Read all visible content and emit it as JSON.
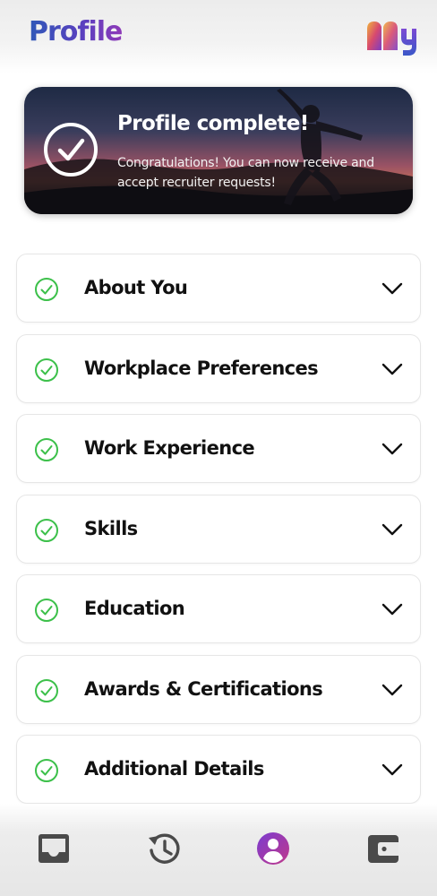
{
  "header": {
    "title": "Profile",
    "logo_icon": "brand-logo-icon"
  },
  "banner": {
    "icon": "check-circle-icon",
    "title": "Profile complete!",
    "text": "Congratulations! You can now receive and accept recruiter requests!"
  },
  "sections": [
    {
      "label": "About You",
      "status_icon": "check-circle-icon",
      "expand_icon": "chevron-down-icon"
    },
    {
      "label": "Workplace Preferences",
      "status_icon": "check-circle-icon",
      "expand_icon": "chevron-down-icon"
    },
    {
      "label": "Work Experience",
      "status_icon": "check-circle-icon",
      "expand_icon": "chevron-down-icon"
    },
    {
      "label": "Skills",
      "status_icon": "check-circle-icon",
      "expand_icon": "chevron-down-icon"
    },
    {
      "label": "Education",
      "status_icon": "check-circle-icon",
      "expand_icon": "chevron-down-icon"
    },
    {
      "label": "Awards & Certifications",
      "status_icon": "check-circle-icon",
      "expand_icon": "chevron-down-icon"
    },
    {
      "label": "Additional Details",
      "status_icon": "check-circle-icon",
      "expand_icon": "chevron-down-icon"
    }
  ],
  "bottom_nav": {
    "items": [
      {
        "icon": "inbox-icon",
        "active": false
      },
      {
        "icon": "history-icon",
        "active": false
      },
      {
        "icon": "profile-icon",
        "active": true
      },
      {
        "icon": "wallet-icon",
        "active": false
      }
    ]
  },
  "colors": {
    "check_green": "#3cc04a",
    "brand_blue": "#2f58b8",
    "brand_purple": "#8e3ab8",
    "nav_inactive": "#4a4a4a"
  }
}
